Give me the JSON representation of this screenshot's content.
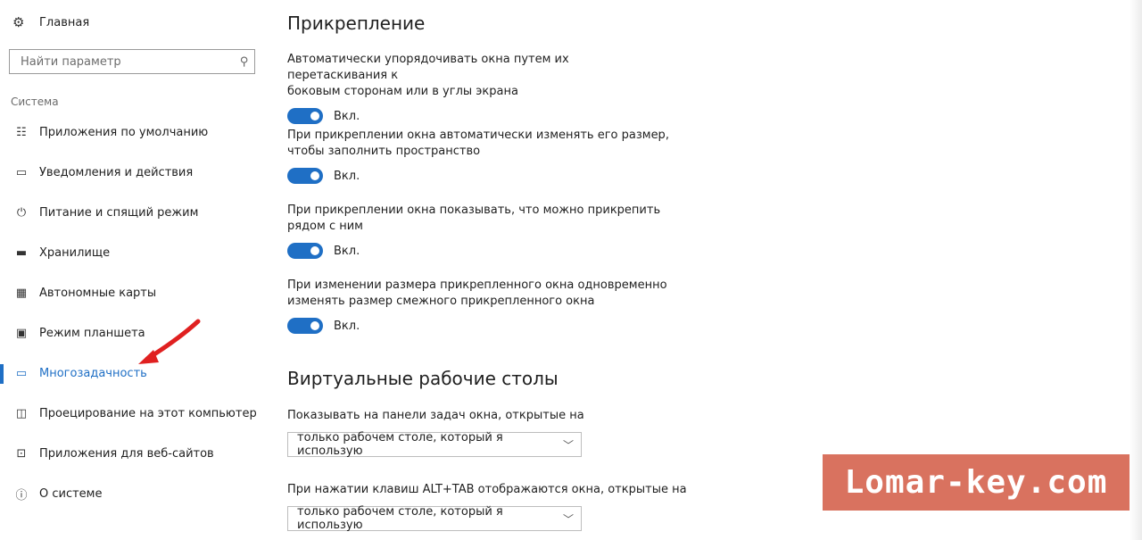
{
  "sidebar": {
    "home_label": "Главная",
    "search_placeholder": "Найти параметр",
    "section_label": "Система",
    "items": [
      {
        "label": "Приложения по умолчанию",
        "icon": "list-icon"
      },
      {
        "label": "Уведомления и действия",
        "icon": "notification-icon"
      },
      {
        "label": "Питание и спящий режим",
        "icon": "power-icon"
      },
      {
        "label": "Хранилище",
        "icon": "storage-icon"
      },
      {
        "label": "Автономные карты",
        "icon": "map-icon"
      },
      {
        "label": "Режим планшета",
        "icon": "tablet-icon"
      },
      {
        "label": "Многозадачность",
        "icon": "multitasking-icon",
        "active": true
      },
      {
        "label": "Проецирование на этот компьютер",
        "icon": "projection-icon"
      },
      {
        "label": "Приложения для веб-сайтов",
        "icon": "web-apps-icon"
      },
      {
        "label": "О системе",
        "icon": "info-icon"
      }
    ]
  },
  "snap": {
    "title": "Прикрепление",
    "settings": [
      {
        "desc_line1": "Автоматически упорядочивать окна путем их перетаскивания к",
        "desc_line2": "боковым сторонам или в углы экрана",
        "state": "Вкл."
      },
      {
        "desc_line1": "При прикреплении окна автоматически изменять его размер,",
        "desc_line2": "чтобы заполнить пространство",
        "state": "Вкл."
      },
      {
        "desc_line1": "При прикреплении окна показывать, что можно прикрепить",
        "desc_line2": "рядом с ним",
        "state": "Вкл."
      },
      {
        "desc_line1": "При изменении размера прикрепленного окна одновременно",
        "desc_line2": "изменять размер смежного прикрепленного окна",
        "state": "Вкл."
      }
    ]
  },
  "virtual_desktops": {
    "title": "Виртуальные рабочие столы",
    "taskbar_label": "Показывать на панели задач окна, открытые на",
    "taskbar_value": "только рабочем столе, который я использую",
    "alttab_label": "При нажатии клавиш ALT+TAB отображаются окна, открытые на",
    "alttab_value": "только рабочем столе, который я использую"
  },
  "watermark": {
    "text": "Lomar-key.com",
    "color": "#d9725f"
  },
  "colors": {
    "accent": "#1f6fc5",
    "arrow": "#e02020"
  }
}
